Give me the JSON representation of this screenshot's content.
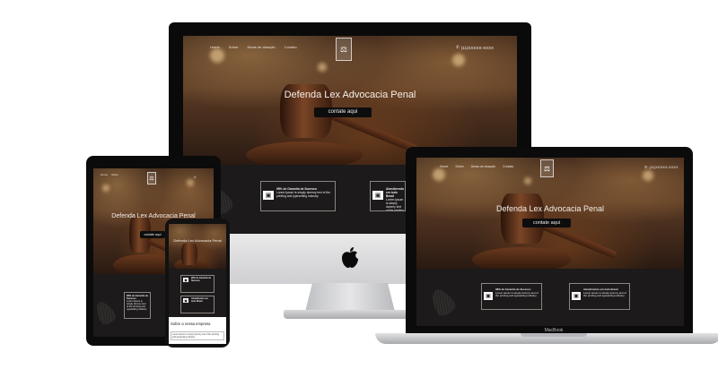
{
  "site": {
    "nav_links": [
      "Home",
      "Sobre",
      "Áreas de atuação",
      "Contato"
    ],
    "logo_glyph": "⚖",
    "phone": "(11)XXXXX-XXXX",
    "hero_title": "Defenda Lex Advocacia Penal",
    "cta_label": "contate aqui",
    "cards": [
      {
        "title": "98% de Garantia de Sucesso",
        "body": "Lorem Ipsum is simply dummy text of the printing and typesetting industry."
      },
      {
        "title": "Atendimento em todo Brasil",
        "body": "Lorem Ipsum is simply dummy text of the printing and typesetting industry."
      }
    ],
    "about_heading": "Sobre a nossa empresa",
    "about_text": "Lorem Ipsum is simply dummy text of the printing and typesetting industry."
  },
  "devices": {
    "macbook_brand": "MacBook",
    "imac_logo": "apple-logo"
  },
  "colors": {
    "dark_band": "#1c1a1a",
    "cta_bg": "#0d0d0d"
  }
}
